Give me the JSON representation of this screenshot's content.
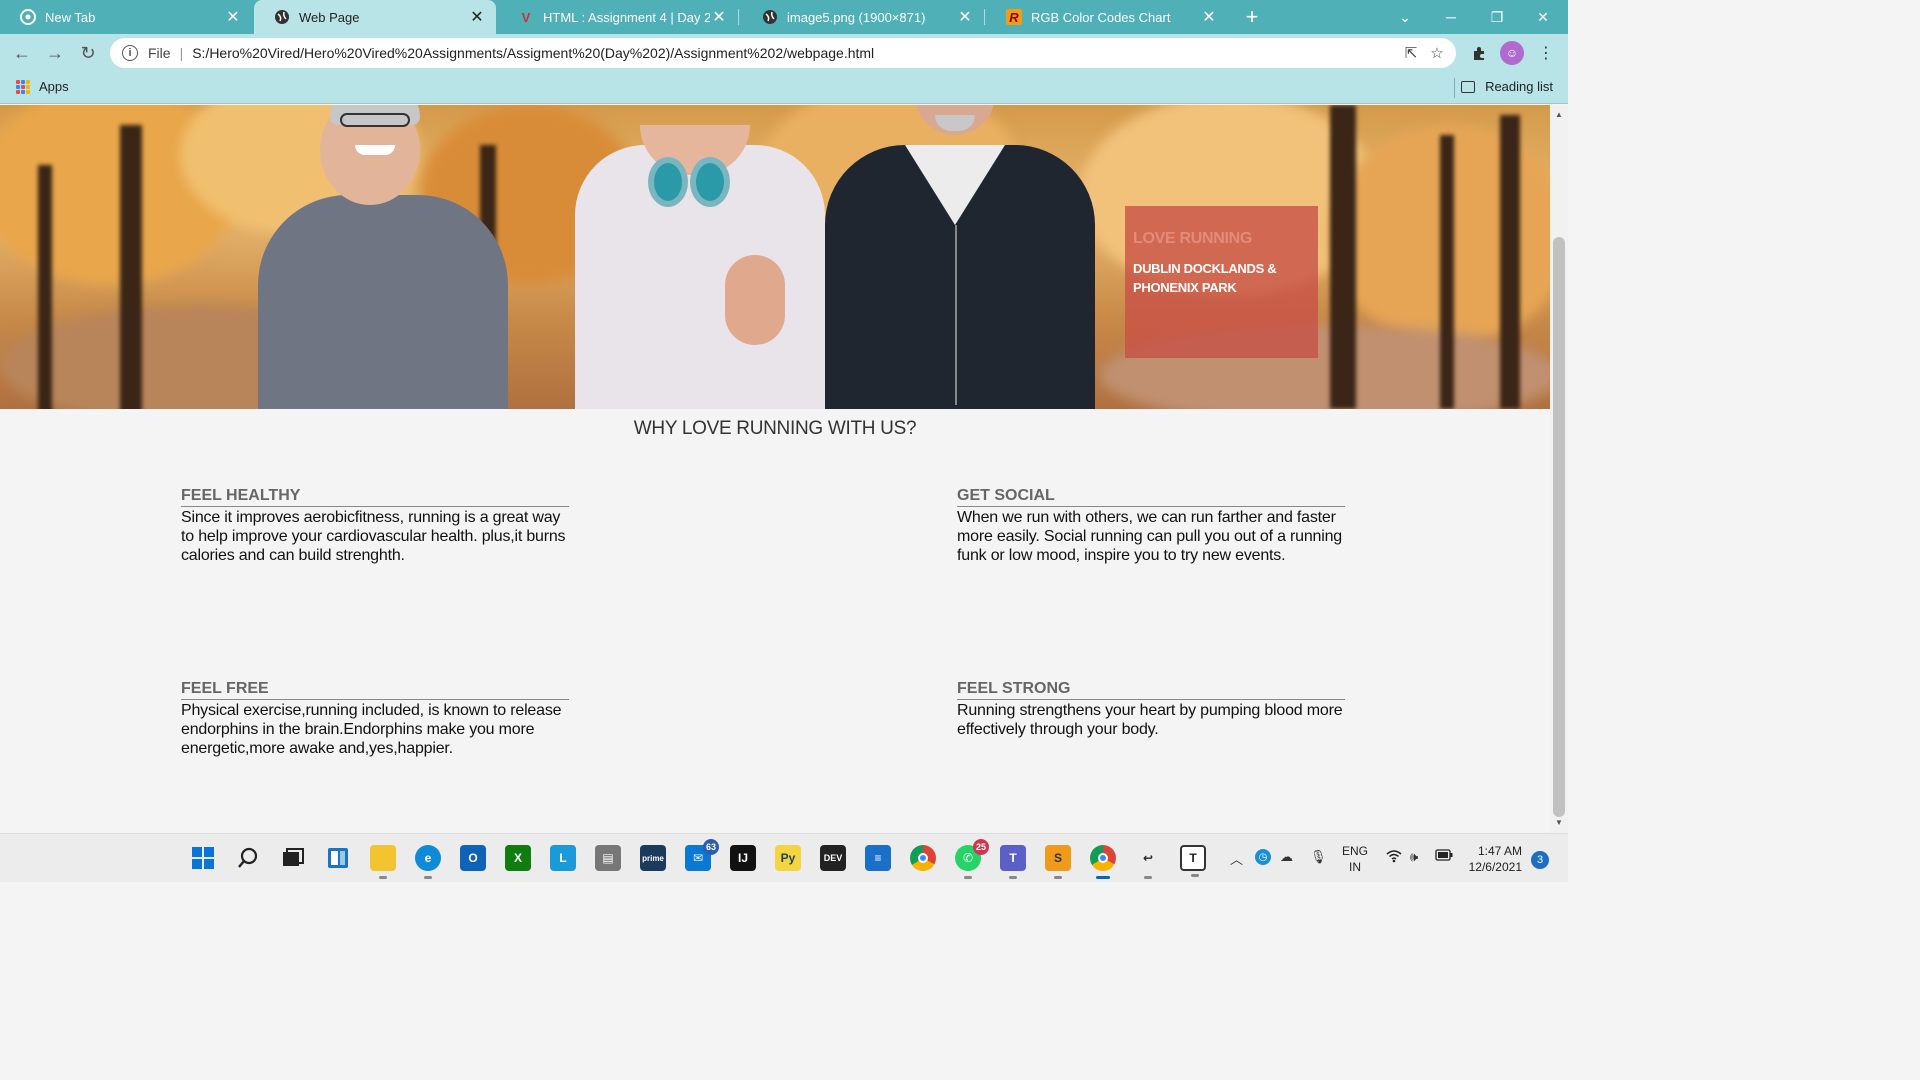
{
  "browser": {
    "tabs": [
      {
        "title": "New Tab",
        "favicon": "chrome-icon"
      },
      {
        "title": "Web Page",
        "favicon": "globe-icon",
        "active": true
      },
      {
        "title": "HTML : Assignment 4 | Day 2",
        "favicon": "v-logo-icon"
      },
      {
        "title": "image5.png (1900×871)",
        "favicon": "globe-icon"
      },
      {
        "title": "RGB Color Codes Chart",
        "favicon": "r-logo-icon"
      }
    ],
    "address": {
      "scheme": "File",
      "url": "S:/Hero%20Vired/Hero%20Vired%20Assignments/Assigment%20(Day%202)/Assignment%202/webpage.html"
    },
    "bookmarks": {
      "apps_label": "Apps",
      "reading_list_label": "Reading list"
    },
    "accent_color": "#4fb0b8",
    "toolbar_color": "#b8e4e8"
  },
  "page": {
    "promo": {
      "title": "LOVE RUNNING",
      "subtitle": "DUBLIN DOCKLANDS & PHONENIX PARK"
    },
    "heading": "WHY LOVE RUNNING WITH US?",
    "features": [
      {
        "title": "FEEL HEALTHY",
        "text": "Since it improves aerobicfitness, running is a great way to help improve your cardiovascular health. plus,it burns calories and can build strenghth."
      },
      {
        "title": "GET SOCIAL",
        "text": "When we run with others, we can run farther and faster more easily. Social running can pull you out of a running funk or low mood, inspire you to try new events."
      },
      {
        "title": "FEEL FREE",
        "text": "Physical exercise,running included, is known to release endorphins in the brain.Endorphins make you more energetic,more awake and,yes,happier."
      },
      {
        "title": "FEEL STRONG",
        "text": "Running strengthens your heart by pumping blood more effectively through your body."
      }
    ]
  },
  "taskbar": {
    "badges": {
      "mail": "63",
      "whatsapp": "25"
    },
    "language": {
      "line1": "ENG",
      "line2": "IN"
    },
    "time": "1:47 AM",
    "date": "12/6/2021",
    "notifications": "3"
  }
}
